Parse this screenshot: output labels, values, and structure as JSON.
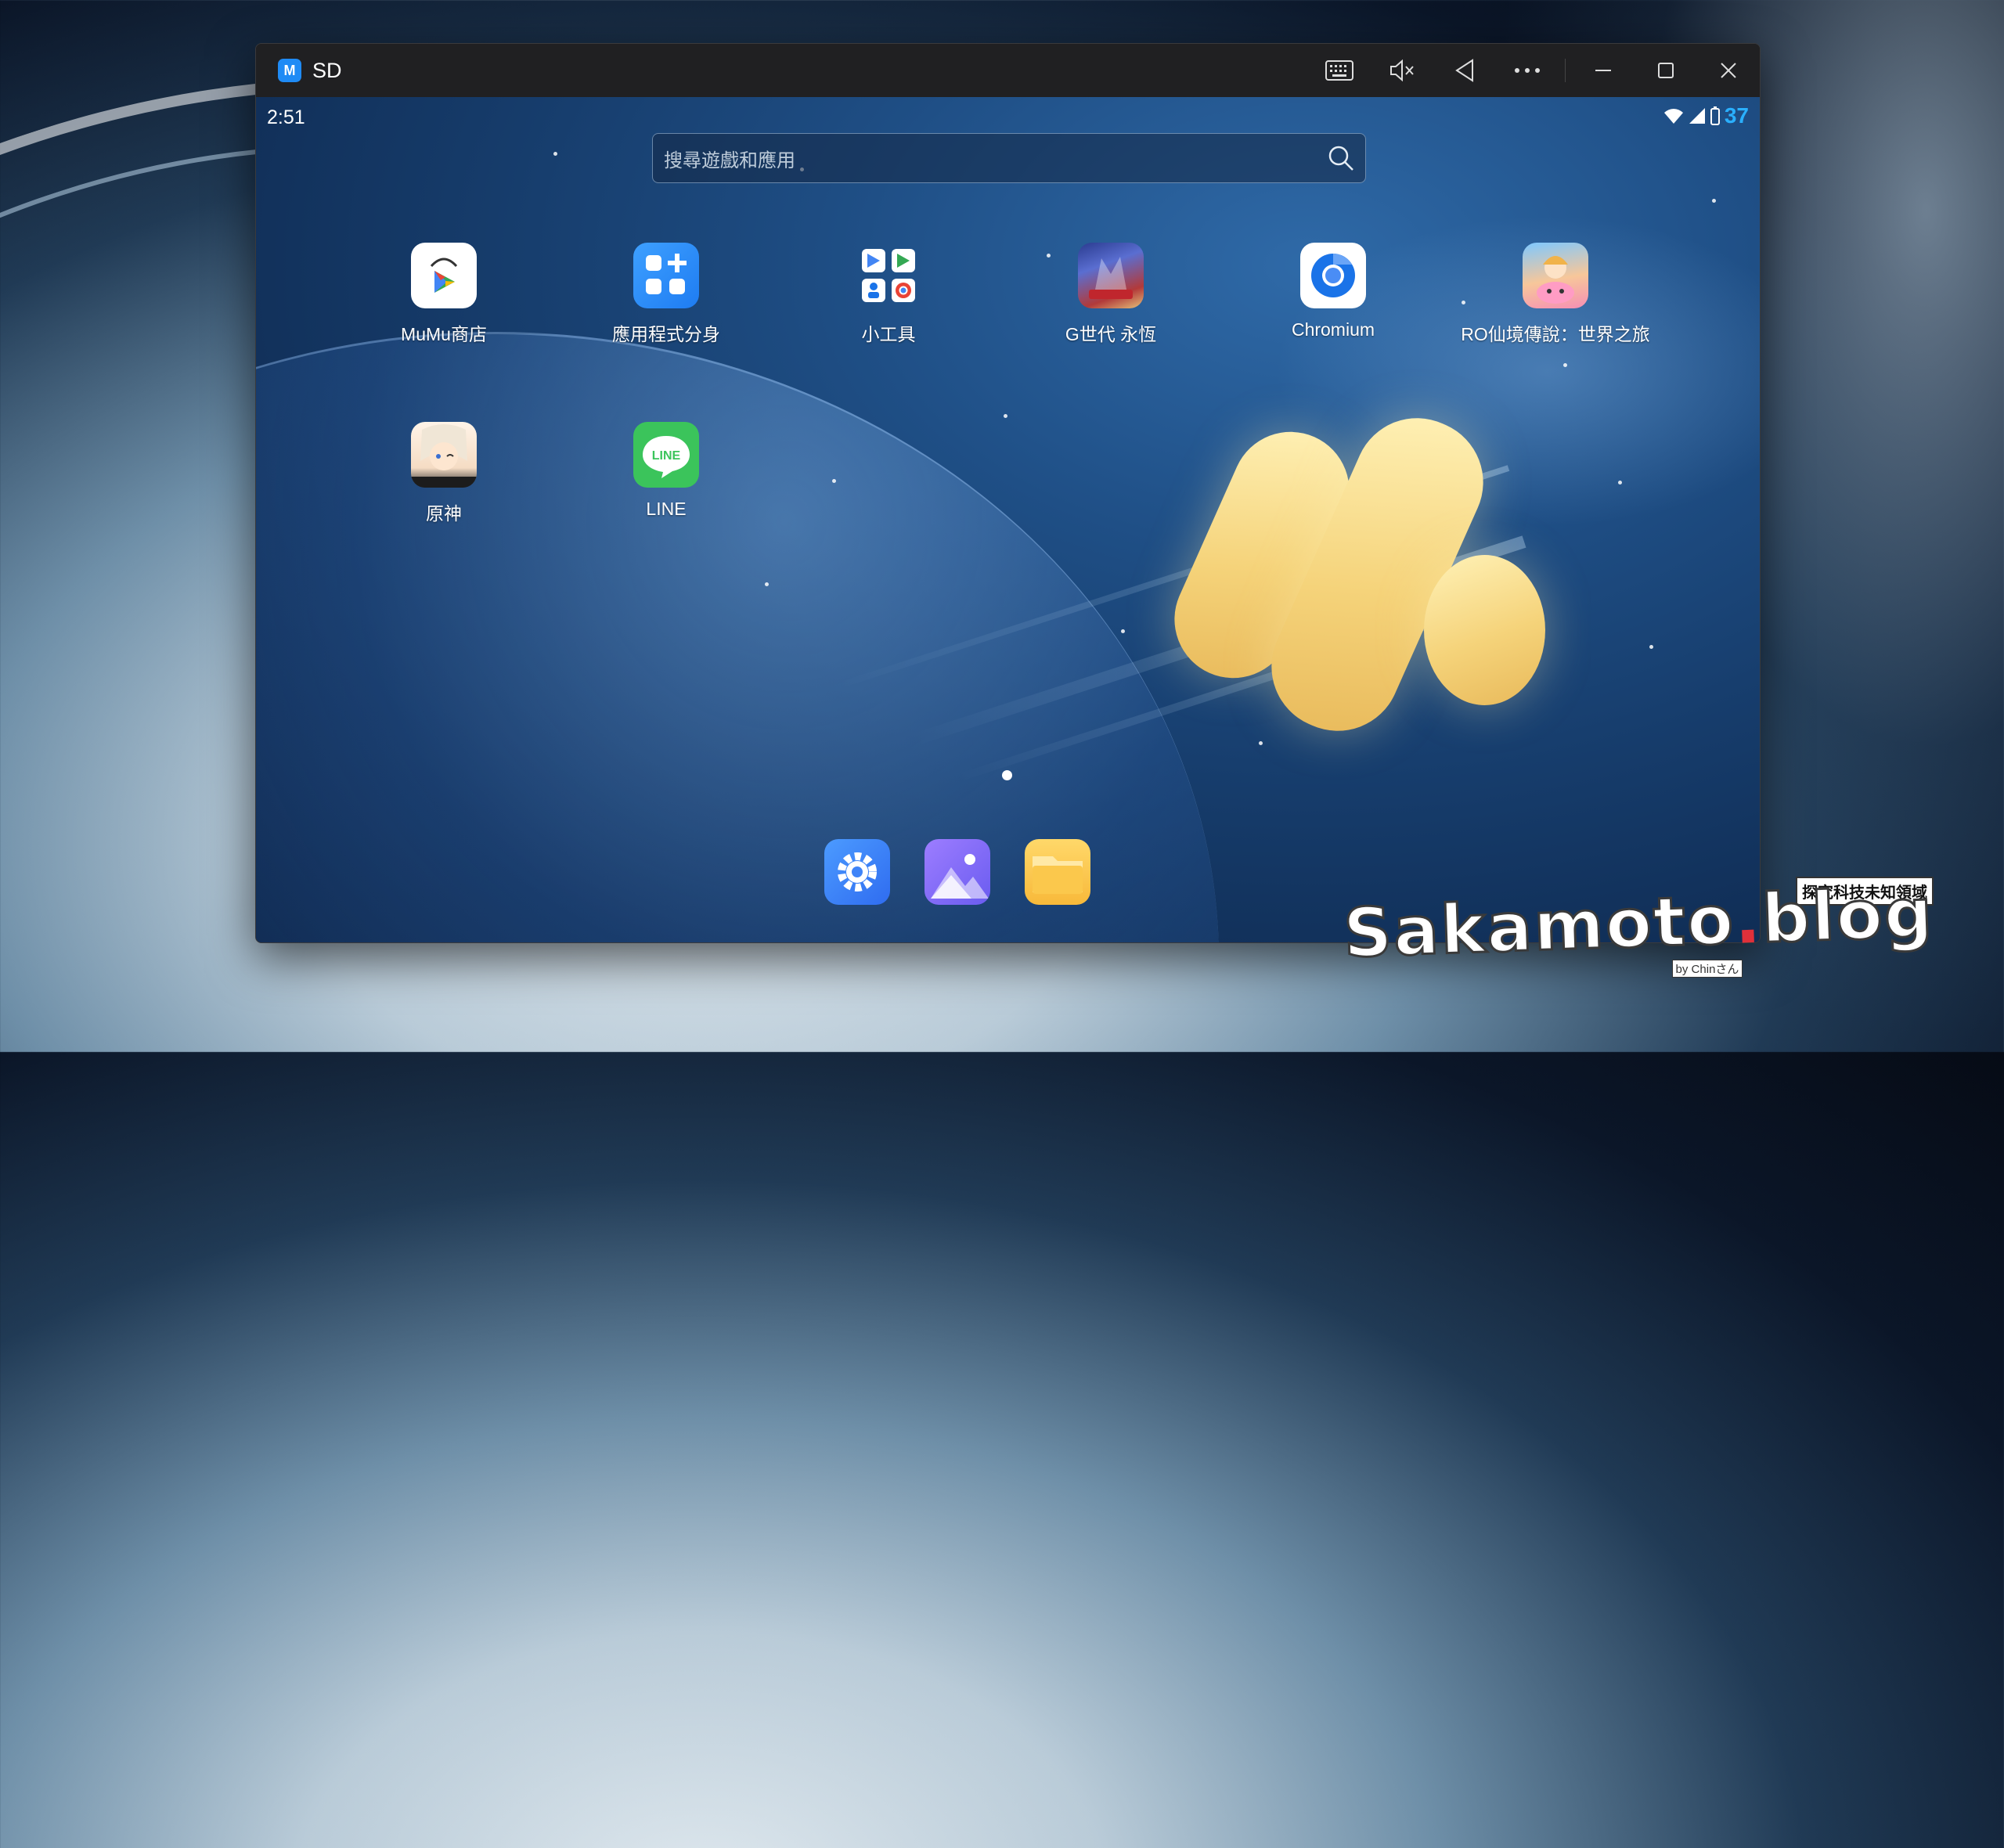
{
  "window": {
    "title": "SD",
    "controls": [
      "keyboard-icon",
      "mute-icon",
      "back-icon",
      "more-icon",
      "minimize-icon",
      "maximize-icon",
      "close-icon"
    ]
  },
  "status_bar": {
    "time": "2:51",
    "battery": "37"
  },
  "search": {
    "placeholder": "搜尋遊戲和應用"
  },
  "apps": [
    {
      "label": "MuMu商店",
      "icon": "play-store-icon"
    },
    {
      "label": "應用程式分身",
      "icon": "app-clone-icon"
    },
    {
      "label": "小工具",
      "icon": "tools-folder-icon"
    },
    {
      "label": "G世代 永恆",
      "icon": "g-generation-icon"
    },
    {
      "label": "Chromium",
      "icon": "chromium-icon"
    },
    {
      "label": "RO仙境傳說：世界之旅",
      "icon": "ro-game-icon"
    },
    {
      "label": "原神",
      "icon": "genshin-icon"
    },
    {
      "label": "LINE",
      "icon": "line-icon"
    }
  ],
  "dock": [
    {
      "icon": "settings-icon"
    },
    {
      "icon": "gallery-icon"
    },
    {
      "icon": "files-icon"
    }
  ],
  "watermark": {
    "main": "Sakamoto",
    "dot": ".",
    "suffix": "blog",
    "tag": "探究科技未知領域",
    "by": "by Chinさん"
  },
  "colors": {
    "accent": "#1f8bf5",
    "battery": "#2ab0ff",
    "line_green": "#3bc45b"
  }
}
